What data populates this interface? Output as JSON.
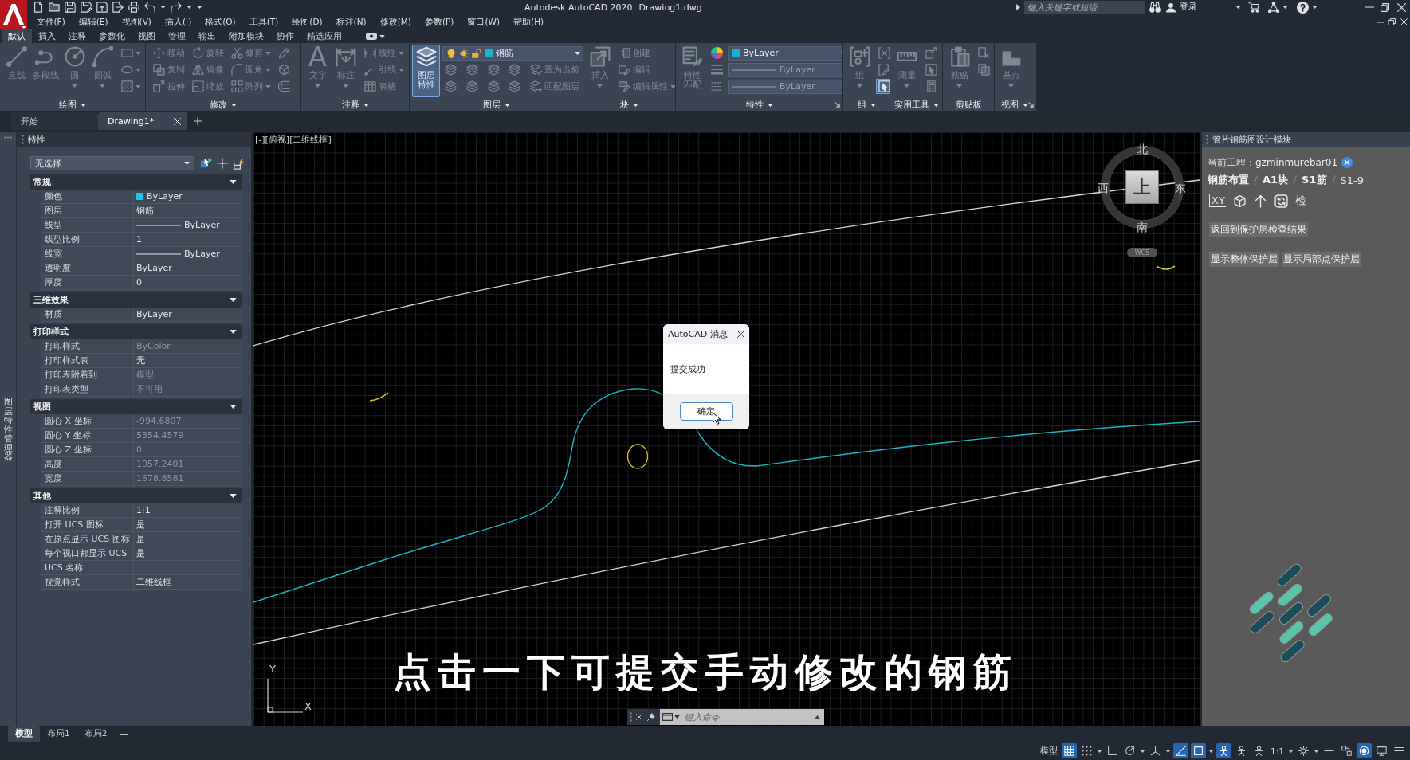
{
  "title_bar": {
    "title": "Autodesk AutoCAD 2020",
    "document": "Drawing1.dwg",
    "search": {
      "placeholder": "键入关键字或短语"
    },
    "sign_in": "登录"
  },
  "menu_bar": [
    "文件(F)",
    "编辑(E)",
    "视图(V)",
    "插入(I)",
    "格式(O)",
    "工具(T)",
    "绘图(D)",
    "标注(N)",
    "修改(M)",
    "参数(P)",
    "窗口(W)",
    "帮助(H)"
  ],
  "ribbon": {
    "disabled": true,
    "tabs": [
      {
        "label": "默认",
        "selected": true
      },
      {
        "label": "插入",
        "selected": false
      },
      {
        "label": "注释",
        "selected": false
      },
      {
        "label": "参数化",
        "selected": false
      },
      {
        "label": "视图",
        "selected": false
      },
      {
        "label": "管理",
        "selected": false
      },
      {
        "label": "输出",
        "selected": false
      },
      {
        "label": "附加模块",
        "selected": false
      },
      {
        "label": "协作",
        "selected": false
      },
      {
        "label": "精选应用",
        "selected": false
      }
    ],
    "panels": [
      {
        "title": "绘图",
        "large": [
          {
            "label": "直线",
            "on": false
          },
          {
            "label": "多段线",
            "on": false
          },
          {
            "label": "圆",
            "on": false
          },
          {
            "label": "圆弧",
            "on": false
          }
        ],
        "rows": [
          [
            {
              "kind": "icon",
              "on": false
            }
          ],
          [
            {
              "kind": "icon",
              "on": false
            }
          ],
          [
            {
              "kind": "icon",
              "on": false
            }
          ]
        ]
      },
      {
        "title": "修改",
        "rows": [
          [
            {
              "kind": "small",
              "label": "移动",
              "on": false
            },
            {
              "kind": "small",
              "label": "旋转",
              "on": false
            },
            {
              "kind": "small",
              "label": "修剪",
              "on": false
            },
            {
              "kind": "icon",
              "on": false
            }
          ],
          [
            {
              "kind": "small",
              "label": "复制",
              "on": false
            },
            {
              "kind": "small",
              "label": "镜像",
              "on": false
            },
            {
              "kind": "small",
              "label": "圆角",
              "on": false
            },
            {
              "kind": "icon",
              "on": false
            }
          ],
          [
            {
              "kind": "small",
              "label": "拉伸",
              "on": false
            },
            {
              "kind": "small",
              "label": "缩放",
              "on": false
            },
            {
              "kind": "small",
              "label": "阵列",
              "on": false
            },
            {
              "kind": "icon",
              "on": false
            }
          ]
        ]
      },
      {
        "title": "注释",
        "large": [
          {
            "label": "文字",
            "glyph": "A",
            "on": false
          },
          {
            "label": "标注",
            "on": false
          }
        ],
        "rows": [
          [
            {
              "kind": "small",
              "label": "线性",
              "on": false
            }
          ],
          [
            {
              "kind": "small",
              "label": "引线",
              "on": false
            }
          ],
          [
            {
              "kind": "small",
              "label": "表格",
              "on": false
            }
          ]
        ]
      },
      {
        "title": "图层",
        "large": [
          {
            "label": "图层特性",
            "on": true
          }
        ],
        "rows": [
          [
            {
              "kind": "layer_combo",
              "value": "钢筋"
            }
          ],
          [
            {
              "kind": "icon",
              "on": false
            },
            {
              "kind": "icon",
              "on": false
            },
            {
              "kind": "icon",
              "on": false
            },
            {
              "kind": "icon",
              "on": false
            },
            {
              "kind": "small",
              "label": "置为当前",
              "on": false
            }
          ],
          [
            {
              "kind": "icon",
              "on": false
            },
            {
              "kind": "icon",
              "on": false
            },
            {
              "kind": "icon",
              "on": false
            },
            {
              "kind": "icon",
              "on": false
            },
            {
              "kind": "small",
              "label": "匹配图层",
              "on": false
            }
          ]
        ]
      },
      {
        "title": "块",
        "large": [
          {
            "label": "插入",
            "on": false
          }
        ],
        "rows": [
          [
            {
              "kind": "small",
              "label": "创建",
              "on": false
            }
          ],
          [
            {
              "kind": "small",
              "label": "编辑",
              "on": false
            }
          ],
          [
            {
              "kind": "small",
              "label": "编辑属性",
              "on": false
            }
          ]
        ]
      },
      {
        "title": "特性",
        "large": [
          {
            "label": "特性匹配",
            "on": false
          }
        ],
        "rows": [
          [
            {
              "kind": "icon",
              "on": false
            },
            {
              "kind": "color_combo",
              "value": "ByLayer"
            }
          ],
          [
            {
              "kind": "icon",
              "on": false
            },
            {
              "kind": "line_combo",
              "value": "ByLayer"
            }
          ],
          [
            {
              "kind": "icon",
              "on": false
            },
            {
              "kind": "line_combo",
              "value": "ByLayer"
            }
          ]
        ]
      },
      {
        "title": "组",
        "large": [
          {
            "label": "组",
            "on": false
          }
        ],
        "rows": [
          [
            {
              "kind": "icon",
              "on": false
            }
          ],
          [
            {
              "kind": "icon",
              "on": false
            }
          ],
          [
            {
              "kind": "icon",
              "on": true
            }
          ]
        ]
      },
      {
        "title": "实用工具",
        "large": [
          {
            "label": "测量",
            "on": false
          }
        ],
        "rows": [
          [
            {
              "kind": "icon",
              "on": false
            }
          ],
          [
            {
              "kind": "icon",
              "on": false
            }
          ],
          [
            {
              "kind": "icon",
              "on": false
            }
          ]
        ]
      },
      {
        "title": "剪贴板",
        "large": [
          {
            "label": "粘贴",
            "on": false
          }
        ],
        "rows": [
          [
            {
              "kind": "icon",
              "on": false
            }
          ],
          [
            {
              "kind": "icon",
              "on": false
            }
          ]
        ]
      },
      {
        "title": "视图",
        "large": [
          {
            "label": "基点",
            "on": false
          }
        ]
      }
    ]
  },
  "document_tabs": [
    {
      "label": "开始",
      "selected": false
    },
    {
      "label": "Drawing1*",
      "selected": true
    }
  ],
  "layer_manager_tab": "图层特性管理器",
  "properties": {
    "title": "特性",
    "selection": "无选择",
    "sections": [
      {
        "title": "常规",
        "expanded": true,
        "rows": [
          {
            "label": "颜色",
            "value": "ByLayer",
            "kind": "color",
            "disabled": false
          },
          {
            "label": "图层",
            "value": "钢筋",
            "kind": "text",
            "disabled": false
          },
          {
            "label": "线型",
            "value": "ByLayer",
            "kind": "line",
            "disabled": false
          },
          {
            "label": "线型比例",
            "value": "1",
            "kind": "text",
            "disabled": false
          },
          {
            "label": "线宽",
            "value": "ByLayer",
            "kind": "line",
            "disabled": false
          },
          {
            "label": "透明度",
            "value": "ByLayer",
            "kind": "text",
            "disabled": false
          },
          {
            "label": "厚度",
            "value": "0",
            "kind": "text",
            "disabled": false
          }
        ]
      },
      {
        "title": "三维效果",
        "expanded": true,
        "rows": [
          {
            "label": "材质",
            "value": "ByLayer",
            "kind": "text",
            "disabled": false
          }
        ]
      },
      {
        "title": "打印样式",
        "expanded": true,
        "rows": [
          {
            "label": "打印样式",
            "value": "ByColor",
            "kind": "text",
            "disabled": true
          },
          {
            "label": "打印样式表",
            "value": "无",
            "kind": "text",
            "disabled": false
          },
          {
            "label": "打印表附着到",
            "value": "模型",
            "kind": "text",
            "disabled": true
          },
          {
            "label": "打印表类型",
            "value": "不可用",
            "kind": "text",
            "disabled": true
          }
        ]
      },
      {
        "title": "视图",
        "expanded": true,
        "rows": [
          {
            "label": "圆心 X 坐标",
            "value": "-994.6807",
            "kind": "text",
            "disabled": true
          },
          {
            "label": "圆心 Y 坐标",
            "value": "5354.4579",
            "kind": "text",
            "disabled": true
          },
          {
            "label": "圆心 Z 坐标",
            "value": "0",
            "kind": "text",
            "disabled": true
          },
          {
            "label": "高度",
            "value": "1057.2401",
            "kind": "text",
            "disabled": true
          },
          {
            "label": "宽度",
            "value": "1678.8581",
            "kind": "text",
            "disabled": true
          }
        ]
      },
      {
        "title": "其他",
        "expanded": true,
        "rows": [
          {
            "label": "注释比例",
            "value": "1:1",
            "kind": "text",
            "disabled": false
          },
          {
            "label": "打开 UCS 图标",
            "value": "是",
            "kind": "text",
            "disabled": false
          },
          {
            "label": "在原点显示 UCS 图标",
            "value": "是",
            "kind": "text",
            "disabled": false
          },
          {
            "label": "每个视口都显示 UCS",
            "value": "是",
            "kind": "text",
            "disabled": false
          },
          {
            "label": "UCS 名称",
            "kind": "text",
            "disabled": false
          },
          {
            "label": "视觉样式",
            "value": "二维线框",
            "kind": "text",
            "disabled": false
          }
        ]
      }
    ]
  },
  "viewport": {
    "label": "[-][俯视][二维线框]",
    "viewcube": {
      "north": "北",
      "west": "西",
      "face": "上",
      "east": "东",
      "south": "南",
      "wcs": "WCS"
    },
    "dialog": {
      "title": "AutoCAD 消息",
      "message": "提交成功",
      "button": "确定"
    },
    "ucs": {
      "y": "Y",
      "x": "X"
    },
    "caption": "点击一下可提交手动修改的钢筋",
    "command_line": {
      "placeholder": "键入命令"
    }
  },
  "side_panel": {
    "title": "管片钢筋图设计模块",
    "project_label": "当前工程：",
    "project": "gzminmurebar01",
    "breadcrumb": [
      {
        "label": "钢筋布置",
        "selected": false
      },
      {
        "label": "A1块",
        "selected": false
      },
      {
        "label": "S1筋",
        "selected": false
      },
      {
        "label": "S1-9",
        "selected": true
      }
    ],
    "toolbar": [
      {
        "kind": "glyph",
        "label": "XY"
      },
      {
        "kind": "icon"
      },
      {
        "kind": "icon"
      },
      {
        "kind": "icon"
      },
      {
        "kind": "glyph",
        "label": "检"
      }
    ],
    "button_rows": [
      [
        "返回到保护层检查结果"
      ],
      [
        "显示整体保护层",
        "显示局部点保护层"
      ]
    ]
  },
  "layout_tabs": [
    {
      "label": "模型",
      "selected": true
    },
    {
      "label": "布局1",
      "selected": false
    },
    {
      "label": "布局2",
      "selected": false
    }
  ],
  "status_bar": {
    "items": [
      {
        "kind": "text",
        "label": "模型"
      },
      {
        "kind": "toggle",
        "on": true
      },
      {
        "kind": "toggle",
        "on": false
      },
      {
        "kind": "toggle",
        "on": false
      },
      {
        "kind": "toggle",
        "on": false
      },
      {
        "kind": "toggle",
        "on": false
      },
      {
        "kind": "toggle",
        "on": true
      },
      {
        "kind": "toggle",
        "on": true
      },
      {
        "kind": "toggle",
        "on": true
      },
      {
        "kind": "toggle",
        "on": false
      },
      {
        "kind": "toggle",
        "on": false
      },
      {
        "kind": "text",
        "label": "1:1"
      },
      {
        "kind": "toggle",
        "on": false
      },
      {
        "kind": "toggle",
        "on": false
      },
      {
        "kind": "toggle",
        "on": false
      },
      {
        "kind": "toggle",
        "on": true
      },
      {
        "kind": "toggle",
        "on": false
      },
      {
        "kind": "toggle",
        "on": false
      }
    ]
  }
}
